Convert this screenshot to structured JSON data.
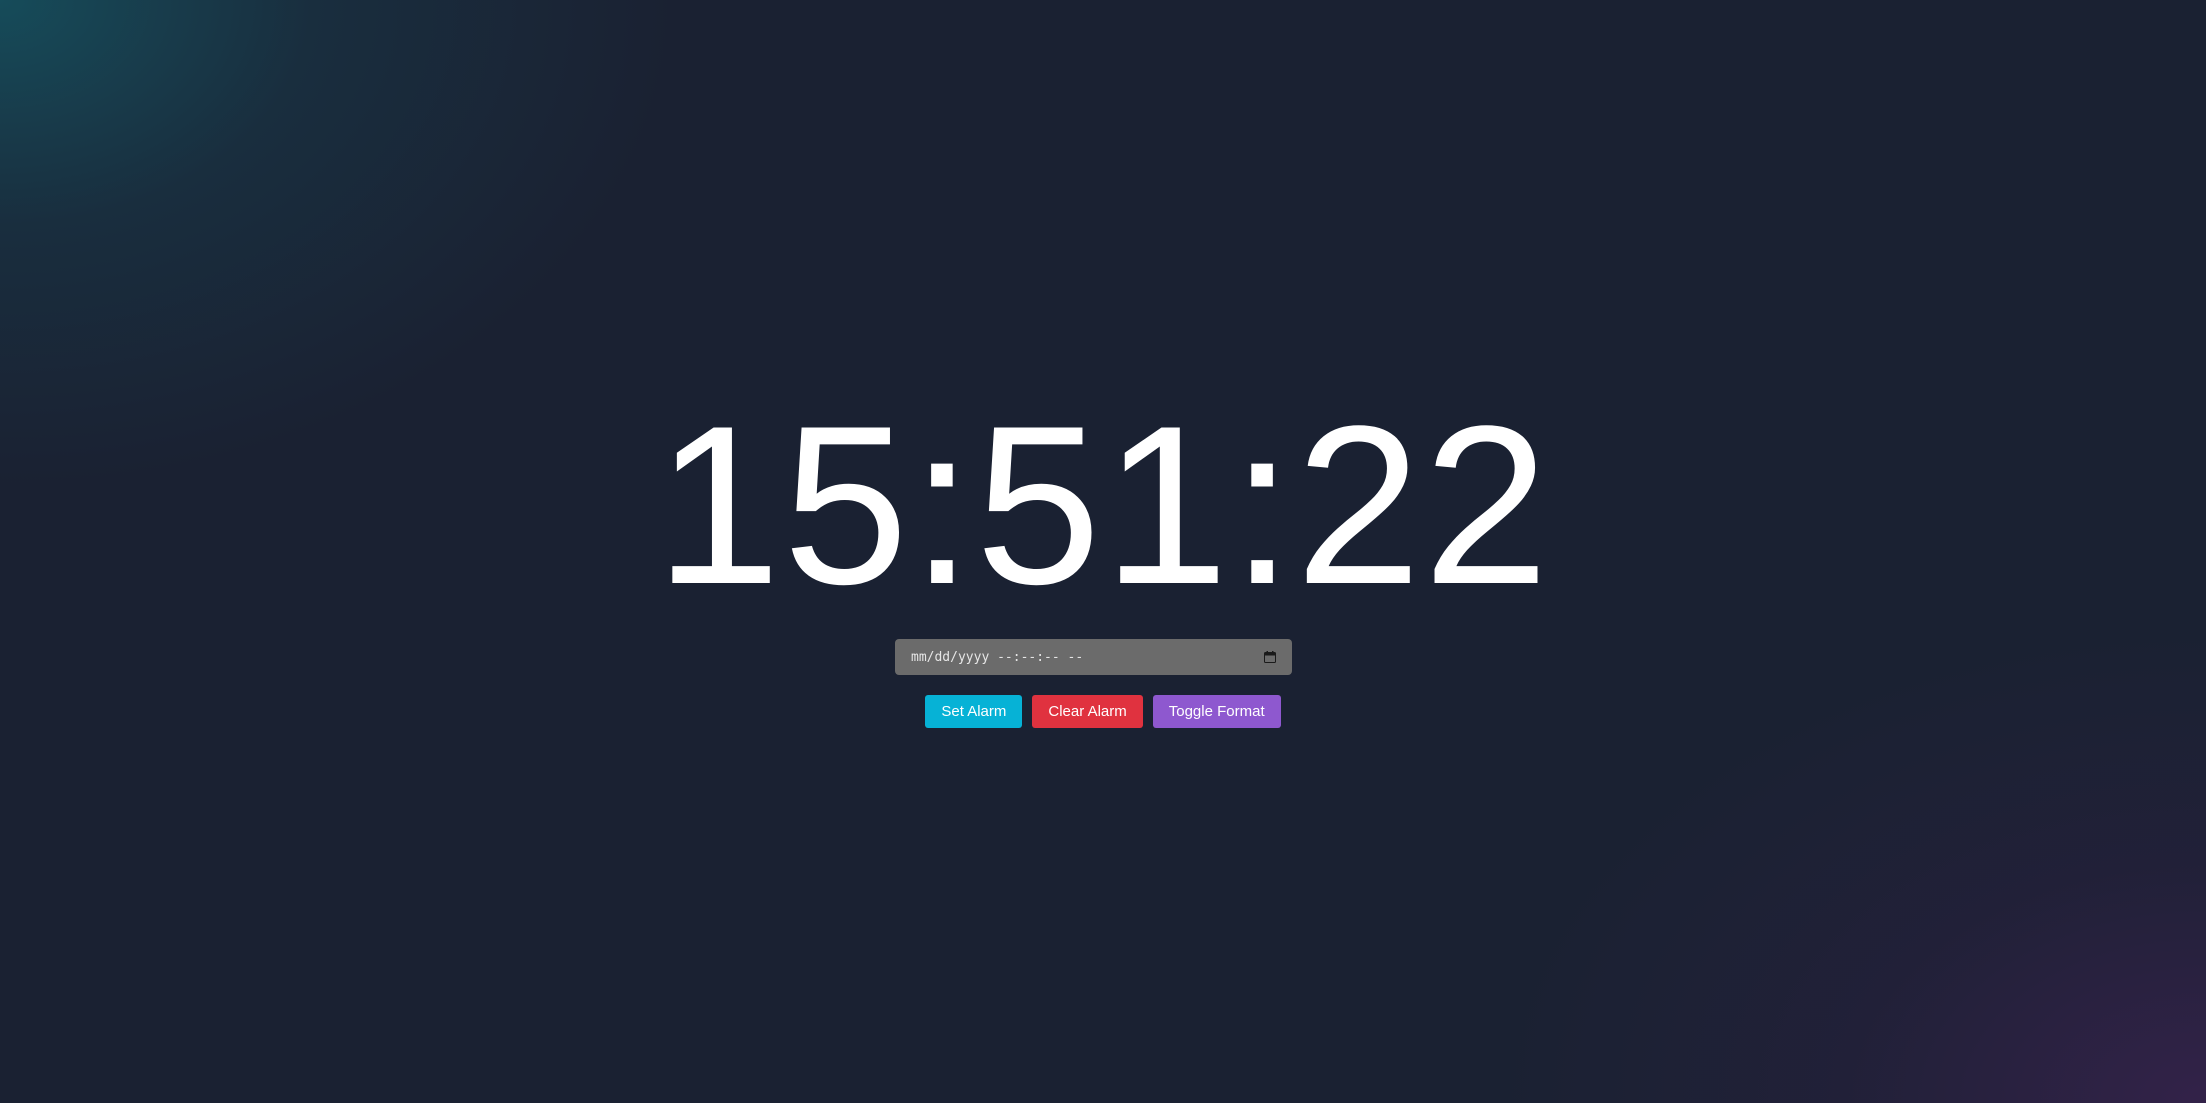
{
  "clock": {
    "time": "15:51:22"
  },
  "alarm_input": {
    "placeholder": "mm/dd/yyyy --:--:-- --",
    "icon": "calendar-icon"
  },
  "buttons": {
    "set_alarm": "Set Alarm",
    "clear_alarm": "Clear Alarm",
    "toggle_format": "Toggle Format"
  },
  "colors": {
    "set_alarm": "#06b2d6",
    "clear_alarm": "#e0323f",
    "toggle_format": "#8e58cf",
    "background": "#1a2132"
  }
}
